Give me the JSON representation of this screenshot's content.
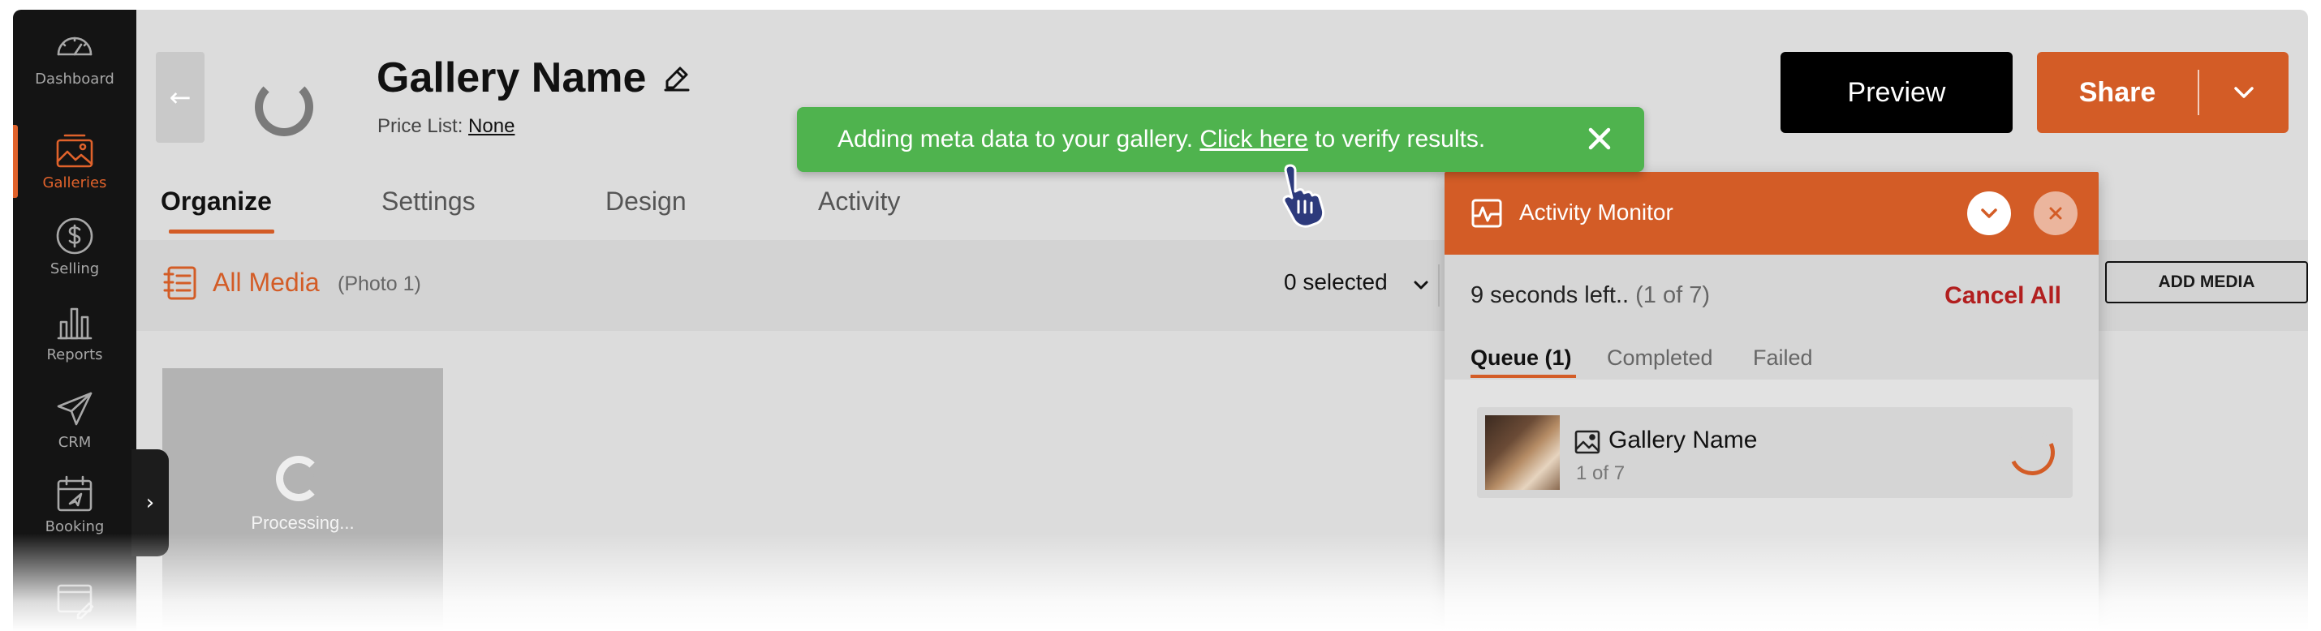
{
  "sidebar": {
    "items": [
      {
        "label": "Dashboard",
        "icon": "speedometer-icon"
      },
      {
        "label": "Galleries",
        "icon": "image-icon",
        "active": true
      },
      {
        "label": "Selling",
        "icon": "dollar-icon"
      },
      {
        "label": "Reports",
        "icon": "bar-chart-icon"
      },
      {
        "label": "CRM",
        "icon": "paper-plane-icon"
      },
      {
        "label": "Booking",
        "icon": "calendar-icon"
      },
      {
        "label": "",
        "icon": "website-icon"
      }
    ],
    "collapse_glyph": "›"
  },
  "header": {
    "back_glyph": "←",
    "title": "Gallery Name",
    "price_list_label": "Price List:",
    "price_list_value": "None",
    "preview_label": "Preview",
    "share_label": "Share"
  },
  "tabs": [
    {
      "label": "Organize",
      "active": true
    },
    {
      "label": "Settings"
    },
    {
      "label": "Design"
    },
    {
      "label": "Activity"
    }
  ],
  "toolbar": {
    "all_media_label": "All Media",
    "photo_count": "(Photo 1)",
    "selected_label": "0 selected",
    "add_media_label": "ADD MEDIA"
  },
  "content": {
    "processing_label": "Processing..."
  },
  "toast": {
    "text_before": "Adding meta data to your gallery.",
    "link_text": "Click here",
    "text_after": "to verify results.",
    "color": "#4fb34e"
  },
  "monitor": {
    "title": "Activity Monitor",
    "time_left": "9 seconds left..",
    "progress": "(1 of 7)",
    "cancel_all": "Cancel All",
    "tabs": [
      {
        "label": "Queue (1)",
        "active": true
      },
      {
        "label": "Completed"
      },
      {
        "label": "Failed"
      }
    ],
    "queue": [
      {
        "name": "Gallery Name",
        "count": "1 of 7"
      }
    ]
  },
  "colors": {
    "accent": "#d35c26",
    "sidebar_bg": "#141414",
    "danger": "#b21f1f"
  }
}
